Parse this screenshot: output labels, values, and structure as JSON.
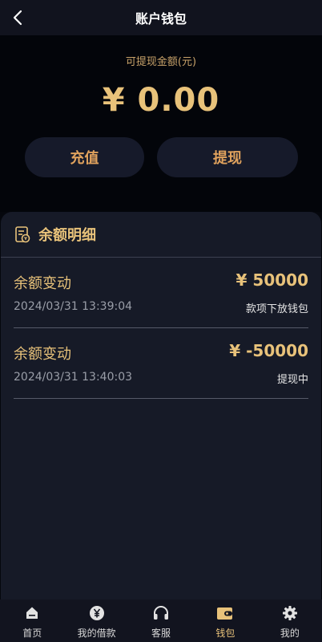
{
  "header": {
    "title": "账户钱包"
  },
  "balance": {
    "label": "可提现金额(元)",
    "amount": "¥ 0.00"
  },
  "actions": {
    "recharge": "充值",
    "withdraw": "提现"
  },
  "details": {
    "title": "余额明细",
    "records": [
      {
        "title": "余额变动",
        "amount": "¥ 50000",
        "time": "2024/03/31 13:39:04",
        "status": "款项下放钱包"
      },
      {
        "title": "余额变动",
        "amount": "¥ -50000",
        "time": "2024/03/31 13:40:03",
        "status": "提现中"
      }
    ]
  },
  "tabbar": {
    "items": [
      {
        "label": "首页",
        "icon": "home-icon"
      },
      {
        "label": "我的借款",
        "icon": "yen-coin-icon"
      },
      {
        "label": "客服",
        "icon": "headset-icon"
      },
      {
        "label": "钱包",
        "icon": "wallet-icon",
        "active": true
      },
      {
        "label": "我的",
        "icon": "gear-icon"
      }
    ]
  },
  "colors": {
    "accent": "#e8c27a",
    "button_text": "#e0a25d",
    "panel": "#161a27"
  }
}
